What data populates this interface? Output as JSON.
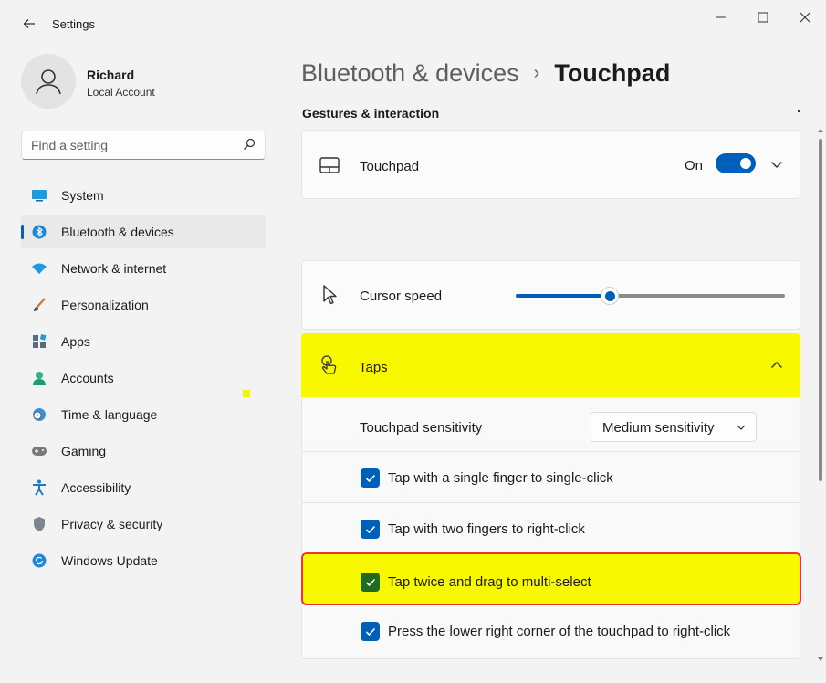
{
  "window": {
    "title": "Settings",
    "back_icon": "back-arrow-icon",
    "minimize_icon": "minimize-icon",
    "maximize_icon": "maximize-icon",
    "close_icon": "close-icon"
  },
  "profile": {
    "name": "Richard",
    "account_type": "Local Account"
  },
  "search": {
    "placeholder": "Find a setting",
    "value": ""
  },
  "sidebar": {
    "items": [
      {
        "label": "System",
        "icon": "system-icon"
      },
      {
        "label": "Bluetooth & devices",
        "icon": "bluetooth-icon",
        "active": true
      },
      {
        "label": "Network & internet",
        "icon": "wifi-icon"
      },
      {
        "label": "Personalization",
        "icon": "brush-icon"
      },
      {
        "label": "Apps",
        "icon": "apps-icon"
      },
      {
        "label": "Accounts",
        "icon": "person-icon"
      },
      {
        "label": "Time & language",
        "icon": "globe-clock-icon"
      },
      {
        "label": "Gaming",
        "icon": "gamepad-icon"
      },
      {
        "label": "Accessibility",
        "icon": "accessibility-icon"
      },
      {
        "label": "Privacy & security",
        "icon": "shield-icon"
      },
      {
        "label": "Windows Update",
        "icon": "update-icon"
      }
    ]
  },
  "main": {
    "breadcrumb_parent": "Bluetooth & devices",
    "breadcrumb_separator": "›",
    "page_title": "Touchpad",
    "section_title": "Gestures & interaction",
    "touchpad": {
      "label": "Touchpad",
      "state_label": "On",
      "enabled": true
    },
    "cursor_speed": {
      "label": "Cursor speed",
      "value_fraction": 0.35
    },
    "taps": {
      "label": "Taps",
      "sensitivity_label": "Touchpad sensitivity",
      "sensitivity_value": "Medium sensitivity",
      "options": [
        {
          "label": "Tap with a single finger to single-click",
          "checked": true
        },
        {
          "label": "Tap with two fingers to right-click",
          "checked": true
        },
        {
          "label": "Tap twice and drag to multi-select",
          "checked": true
        },
        {
          "label": "Press the lower right corner of the touchpad to right-click",
          "checked": true
        }
      ]
    }
  },
  "colors": {
    "accent": "#005fb8",
    "highlight": "#f8f800",
    "highlight_border": "#e53935",
    "background": "#f3f3f3"
  }
}
